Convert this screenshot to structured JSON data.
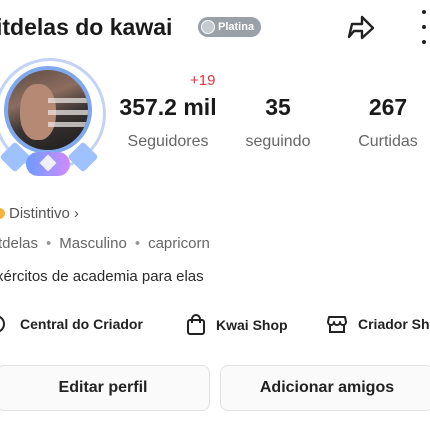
{
  "header": {
    "username": "itdelas do kawai",
    "level_badge": "Platina",
    "share_icon": "share-arrow-icon",
    "more_icon": "more-vertical-icon"
  },
  "avatar": {
    "frame_colors": [
      "#7fa8ef",
      "#9ec1ff",
      "#d08bff"
    ]
  },
  "stats": {
    "followers_delta": "+19",
    "items": [
      {
        "value": "357.2 mil",
        "label": "Seguidores"
      },
      {
        "value": "35",
        "label": "seguindo"
      },
      {
        "value": "267",
        "label": "Curtidas"
      }
    ]
  },
  "badge_link": {
    "label": "Distintivo",
    "chevron": "›"
  },
  "info": {
    "handle": "tdelas",
    "gender": "Masculino",
    "sign": "capricorn"
  },
  "bio": "xércitos de academia para elas",
  "tools": [
    {
      "label": "Central do Criador",
      "icon": "creator-center-icon"
    },
    {
      "label": "Kwai Shop",
      "icon": "shopping-bag-icon"
    },
    {
      "label": "Criador Sh",
      "icon": "store-icon"
    }
  ],
  "actions": {
    "edit": "Editar perfil",
    "add": "Adicionar amigos"
  },
  "colors": {
    "accent_red": "#e8333b",
    "badge_gray": "#9aa0a8",
    "text_dark": "#1a1a1a"
  }
}
